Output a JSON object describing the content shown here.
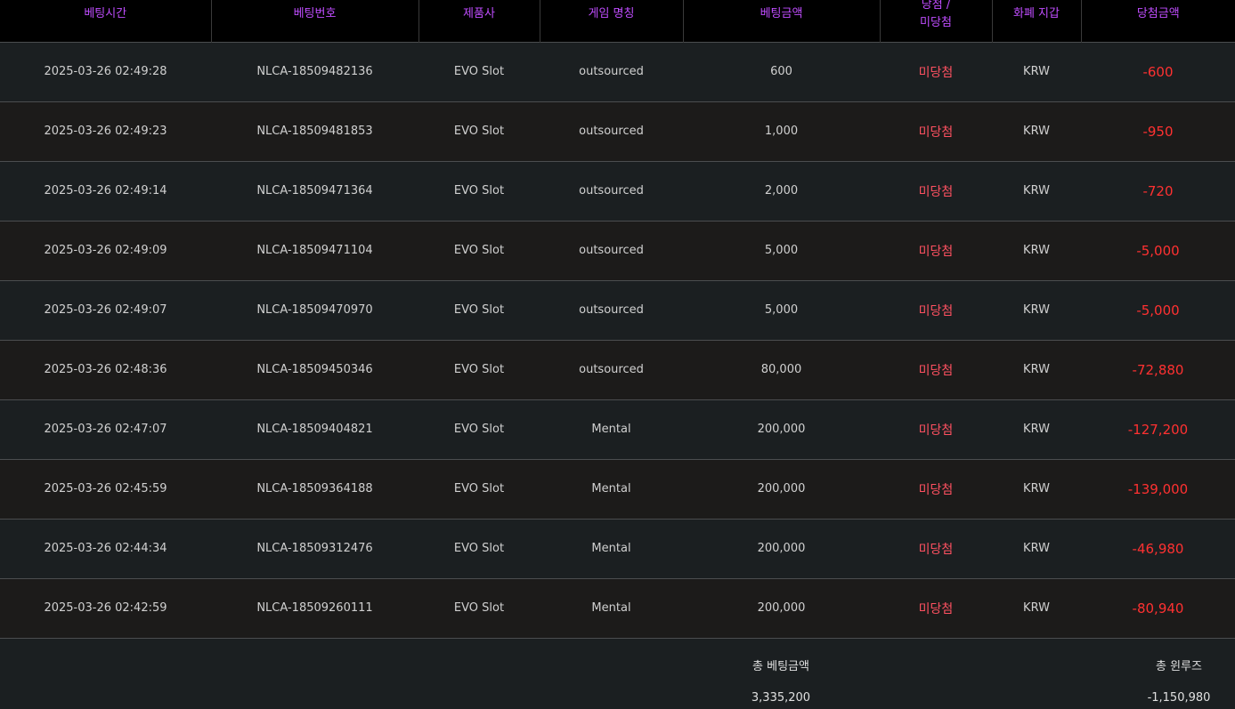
{
  "columns": [
    "베팅시간",
    "베팅번호",
    "제품사",
    "게임 명칭",
    "베팅금액",
    "당첨 /\n미당첨",
    "화폐 지갑",
    "당첨금액"
  ],
  "rows": [
    {
      "time": "2025-03-26 02:49:28",
      "bet_no": "NLCA-18509482136",
      "provider": "EVO Slot",
      "game": "outsourced",
      "amount": "600",
      "status": "미당첨",
      "currency": "KRW",
      "win": "-600"
    },
    {
      "time": "2025-03-26 02:49:23",
      "bet_no": "NLCA-18509481853",
      "provider": "EVO Slot",
      "game": "outsourced",
      "amount": "1,000",
      "status": "미당첨",
      "currency": "KRW",
      "win": "-950"
    },
    {
      "time": "2025-03-26 02:49:14",
      "bet_no": "NLCA-18509471364",
      "provider": "EVO Slot",
      "game": "outsourced",
      "amount": "2,000",
      "status": "미당첨",
      "currency": "KRW",
      "win": "-720"
    },
    {
      "time": "2025-03-26 02:49:09",
      "bet_no": "NLCA-18509471104",
      "provider": "EVO Slot",
      "game": "outsourced",
      "amount": "5,000",
      "status": "미당첨",
      "currency": "KRW",
      "win": "-5,000"
    },
    {
      "time": "2025-03-26 02:49:07",
      "bet_no": "NLCA-18509470970",
      "provider": "EVO Slot",
      "game": "outsourced",
      "amount": "5,000",
      "status": "미당첨",
      "currency": "KRW",
      "win": "-5,000"
    },
    {
      "time": "2025-03-26 02:48:36",
      "bet_no": "NLCA-18509450346",
      "provider": "EVO Slot",
      "game": "outsourced",
      "amount": "80,000",
      "status": "미당첨",
      "currency": "KRW",
      "win": "-72,880"
    },
    {
      "time": "2025-03-26 02:47:07",
      "bet_no": "NLCA-18509404821",
      "provider": "EVO Slot",
      "game": "Mental",
      "amount": "200,000",
      "status": "미당첨",
      "currency": "KRW",
      "win": "-127,200"
    },
    {
      "time": "2025-03-26 02:45:59",
      "bet_no": "NLCA-18509364188",
      "provider": "EVO Slot",
      "game": "Mental",
      "amount": "200,000",
      "status": "미당첨",
      "currency": "KRW",
      "win": "-139,000"
    },
    {
      "time": "2025-03-26 02:44:34",
      "bet_no": "NLCA-18509312476",
      "provider": "EVO Slot",
      "game": "Mental",
      "amount": "200,000",
      "status": "미당첨",
      "currency": "KRW",
      "win": "-46,980"
    },
    {
      "time": "2025-03-26 02:42:59",
      "bet_no": "NLCA-18509260111",
      "provider": "EVO Slot",
      "game": "Mental",
      "amount": "200,000",
      "status": "미당첨",
      "currency": "KRW",
      "win": "-80,940"
    }
  ],
  "totals": {
    "bet_label": "총 베팅금액",
    "bet_value": "3,335,200",
    "winloss_label": "총 윈루즈",
    "winloss_value": "-1,150,980"
  },
  "colors": {
    "header_text": "#c04dff",
    "loss": "#ff3131",
    "status": "#ff5161"
  }
}
